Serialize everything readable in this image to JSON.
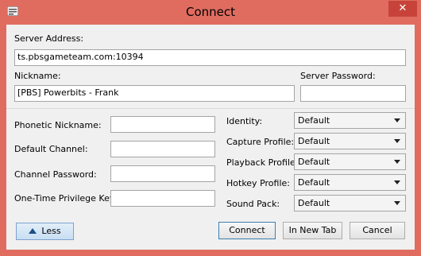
{
  "window": {
    "title": "Connect",
    "close_glyph": "✕"
  },
  "fields": {
    "server_address": {
      "label": "Server Address:",
      "value": "ts.pbsgameteam.com:10394"
    },
    "nickname": {
      "label": "Nickname:",
      "value": "[PBS] Powerbits - Frank"
    },
    "server_password": {
      "label": "Server Password:",
      "value": ""
    },
    "phonetic_nickname": {
      "label": "Phonetic Nickname:",
      "value": ""
    },
    "default_channel": {
      "label": "Default Channel:",
      "value": ""
    },
    "channel_password": {
      "label": "Channel Password:",
      "value": ""
    },
    "privilege_key": {
      "label": "One-Time Privilege Key:",
      "value": ""
    }
  },
  "profiles": {
    "identity": {
      "label": "Identity:",
      "value": "Default"
    },
    "capture": {
      "label": "Capture Profile:",
      "value": "Default"
    },
    "playback": {
      "label": "Playback Profile:",
      "value": "Default"
    },
    "hotkey": {
      "label": "Hotkey Profile:",
      "value": "Default"
    },
    "soundpack": {
      "label": "Sound Pack:",
      "value": "Default"
    }
  },
  "buttons": {
    "less": "Less",
    "connect": "Connect",
    "new_tab": "In New Tab",
    "cancel": "Cancel"
  }
}
